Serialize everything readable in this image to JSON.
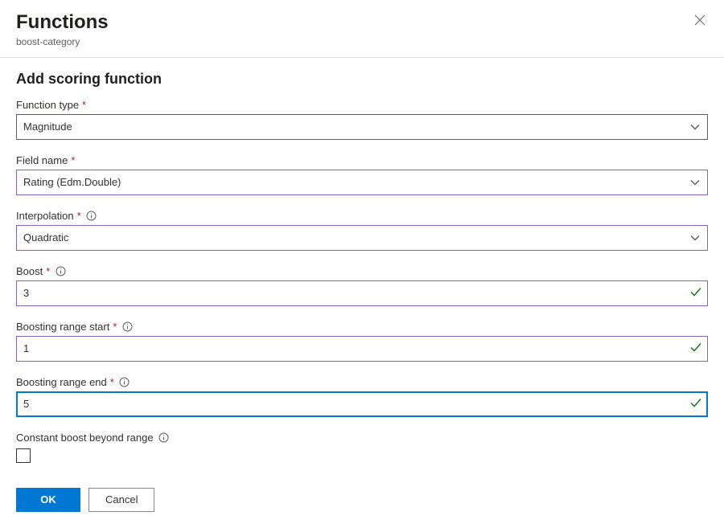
{
  "header": {
    "title": "Functions",
    "subtitle": "boost-category"
  },
  "section": {
    "title": "Add scoring function"
  },
  "fields": {
    "functionType": {
      "label": "Function type",
      "value": "Magnitude"
    },
    "fieldName": {
      "label": "Field name",
      "value": "Rating (Edm.Double)"
    },
    "interpolation": {
      "label": "Interpolation",
      "value": "Quadratic"
    },
    "boost": {
      "label": "Boost",
      "value": "3"
    },
    "rangeStart": {
      "label": "Boosting range start",
      "value": "1"
    },
    "rangeEnd": {
      "label": "Boosting range end",
      "value": "5"
    },
    "constantBoost": {
      "label": "Constant boost beyond range"
    }
  },
  "buttons": {
    "ok": "OK",
    "cancel": "Cancel"
  }
}
